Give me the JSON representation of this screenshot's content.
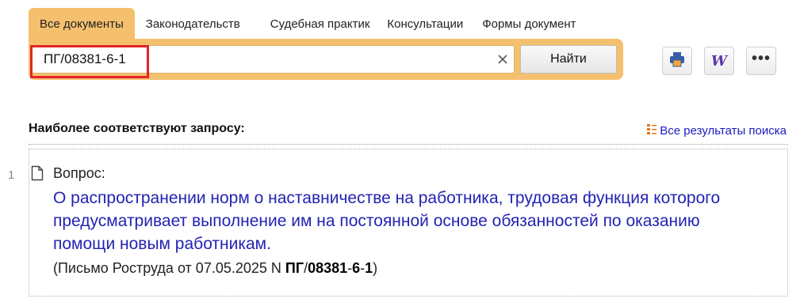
{
  "tabs": [
    {
      "label": "Все документы",
      "active": true
    },
    {
      "label": "Законодательств",
      "active": false
    },
    {
      "label": "Судебная практик",
      "active": false
    },
    {
      "label": "Консультации",
      "active": false
    },
    {
      "label": "Формы документ",
      "active": false
    }
  ],
  "search": {
    "value": "ПГ/08381-6-1",
    "find_label": "Найти"
  },
  "toolbar": {
    "print_icon": "printer-icon",
    "word_icon": "word-export-icon",
    "word_glyph": "W",
    "more_icon": "more-dots-icon",
    "more_glyph": "•••"
  },
  "results": {
    "header": "Наиболее соответствуют запросу:",
    "all_results_label": "Все результаты поиска",
    "items": [
      {
        "number": "1",
        "type": "Вопрос:",
        "title": "О распространении норм о наставничестве на работника, трудовая функция которого предусматривает выполнение им на постоянной основе обязанностей по оказанию помощи новым работникам.",
        "ref_prefix": "(Письмо Роструда от 07.05.2025 N ",
        "ref_parts": [
          "ПГ",
          "/",
          "08381",
          "-",
          "6",
          "-",
          "1"
        ],
        "ref_suffix": ")"
      }
    ]
  },
  "colors": {
    "accent": "#f5c06e",
    "link": "#2323b3",
    "highlight": "#e52525"
  }
}
